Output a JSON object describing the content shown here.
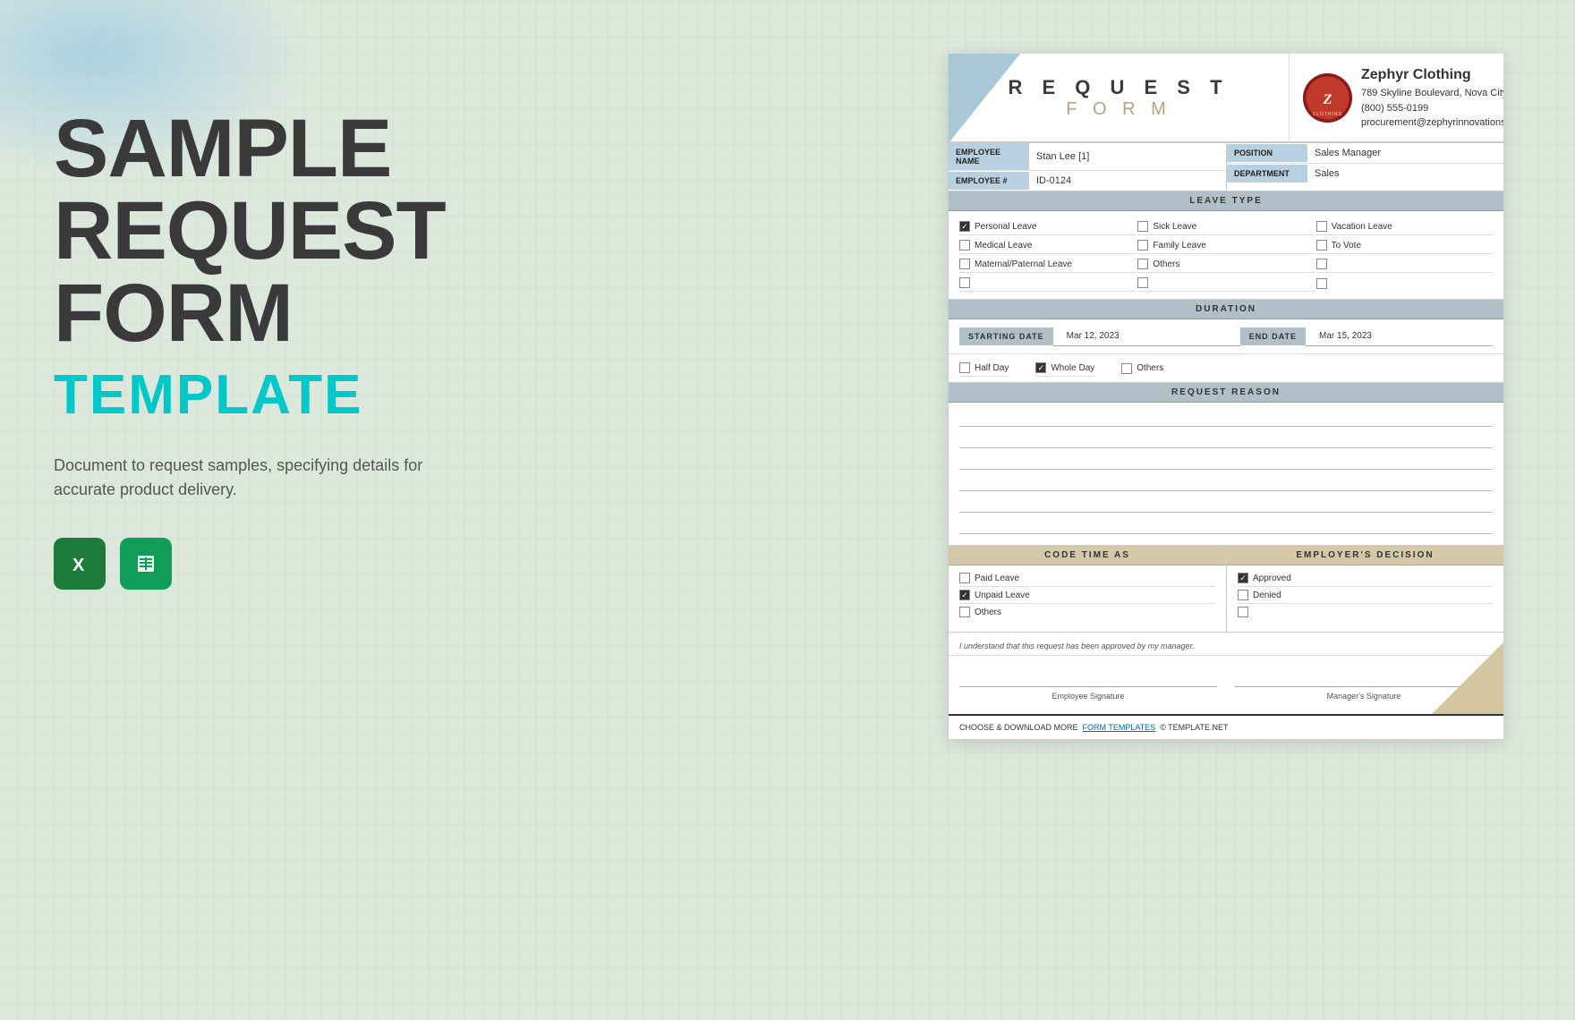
{
  "page": {
    "background_color": "#dde8dd"
  },
  "left": {
    "title_line1": "SAMPLE",
    "title_line2": "REQUEST",
    "title_line3": "FORM",
    "subtitle": "TEMPLATE",
    "description": "Document to request samples, specifying details for accurate product delivery.",
    "icons": [
      {
        "name": "Excel",
        "color": "#1d7a3a",
        "symbol": "X"
      },
      {
        "name": "Sheets",
        "color": "#0f9d58",
        "symbol": "▦"
      }
    ]
  },
  "form": {
    "header": {
      "title_request": "R E Q U E S T",
      "title_form": "F O R M",
      "company_name": "Zephyr Clothing",
      "company_address": "789 Skyline Boulevard, Nova City",
      "company_phone": "(800) 555-0199",
      "company_email": "procurement@zephyrinnovations.com"
    },
    "employee": {
      "name_label": "EMPLOYEE NAME",
      "name_value": "Stan Lee [1]",
      "id_label": "EMPLOYEE #",
      "id_value": "ID-0124",
      "position_label": "POSITION",
      "position_value": "Sales Manager",
      "department_label": "DEPARTMENT",
      "department_value": "Sales"
    },
    "leave_type": {
      "header": "LEAVE TYPE",
      "items": [
        {
          "label": "Personal Leave",
          "checked": true
        },
        {
          "label": "Sick Leave",
          "checked": false
        },
        {
          "label": "Vacation Leave",
          "checked": false
        },
        {
          "label": "Medical Leave",
          "checked": false
        },
        {
          "label": "Family Leave",
          "checked": false
        },
        {
          "label": "To Vote",
          "checked": false
        },
        {
          "label": "Maternal/Paternal Leave",
          "checked": false
        },
        {
          "label": "Others",
          "checked": false
        },
        {
          "label": "",
          "checked": false
        },
        {
          "label": "",
          "checked": false
        },
        {
          "label": "",
          "checked": false
        },
        {
          "label": "",
          "checked": false
        }
      ]
    },
    "duration": {
      "header": "DURATION",
      "starting_date_label": "Starting Date",
      "starting_date_value": "Mar 12, 2023",
      "end_date_label": "End Date",
      "end_date_value": "Mar 15, 2023",
      "duration_options": [
        {
          "label": "Half Day",
          "checked": false
        },
        {
          "label": "Whole Day",
          "checked": true
        },
        {
          "label": "Others",
          "checked": false
        }
      ]
    },
    "request_reason": {
      "header": "REQUEST REASON",
      "lines": 6
    },
    "code_time_as": {
      "header": "CODE TIME AS",
      "items": [
        {
          "label": "Paid Leave",
          "checked": false
        },
        {
          "label": "Unpaid Leave",
          "checked": true
        },
        {
          "label": "Others",
          "checked": false
        }
      ]
    },
    "employer_decision": {
      "header": "EMPLOYER'S DECISION",
      "items": [
        {
          "label": "Approved",
          "checked": true
        },
        {
          "label": "Denied",
          "checked": false
        },
        {
          "label": "",
          "checked": false
        }
      ]
    },
    "acknowledgement": "I understand that this request has been approved by my manager.",
    "signatures": {
      "employee_label": "Employee Signature",
      "manager_label": "Manager's Signature"
    },
    "footer": {
      "text": "CHOOSE & DOWNLOAD MORE",
      "link_text": "FORM TEMPLATES",
      "suffix": "© TEMPLATE.NET"
    }
  }
}
